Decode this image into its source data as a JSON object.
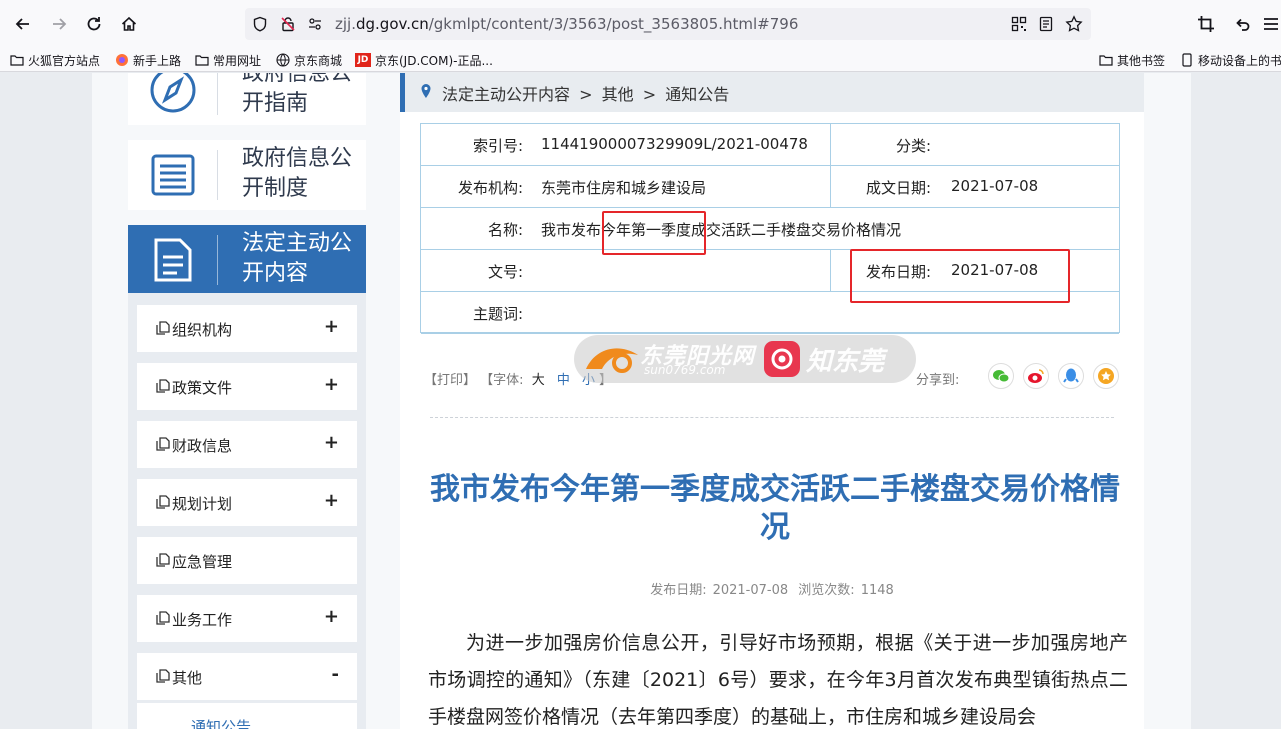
{
  "browser": {
    "url_prefix": "zjj.",
    "url_domain": "dg.gov.cn",
    "url_path": "/gkmlpt/content/3/3563/post_3563805.html#796",
    "bookmarks": [
      "火狐官方站点",
      "新手上路",
      "常用网址",
      "京东商城",
      "京东(JD.COM)-正品..."
    ],
    "bookmarks_right": [
      "其他书签",
      "移动设备上的书签"
    ]
  },
  "sidebar": {
    "panels": [
      {
        "label": "政府信息公开指南",
        "icon": "compass-icon"
      },
      {
        "label": "政府信息公开制度",
        "icon": "list-icon"
      },
      {
        "label": "法定主动公开内容",
        "icon": "document-icon"
      }
    ],
    "menu": [
      {
        "label": "组织机构",
        "toggle": "+"
      },
      {
        "label": "政策文件",
        "toggle": "+"
      },
      {
        "label": "财政信息",
        "toggle": "+"
      },
      {
        "label": "规划计划",
        "toggle": "+"
      },
      {
        "label": "应急管理",
        "toggle": ""
      },
      {
        "label": "业务工作",
        "toggle": "+"
      },
      {
        "label": "其他",
        "toggle": "-"
      }
    ],
    "submenu": "通知公告"
  },
  "breadcrumb": {
    "items": [
      "法定主动公开内容",
      "其他",
      "通知公告"
    ],
    "separator": ">"
  },
  "info": {
    "index_label": "索引号:",
    "index_value": "11441900007329909L/2021-00478",
    "category_label": "分类:",
    "category_value": "",
    "publisher_label": "发布机构:",
    "publisher_value": "东莞市住房和城乡建设局",
    "created_label": "成文日期:",
    "created_value": "2021-07-08",
    "name_label": "名称:",
    "name_value": "我市发布今年第一季度成交活跃二手楼盘交易价格情况",
    "docno_label": "文号:",
    "docno_value": "",
    "pubdate_label": "发布日期:",
    "pubdate_value": "2021-07-08",
    "keywords_label": "主题词:",
    "keywords_value": ""
  },
  "tools": {
    "print": "【打印】",
    "font_label": "【字体:",
    "font_large": "大",
    "font_medium": "中",
    "font_small": "小",
    "font_close": "】",
    "share_label": "分享到:"
  },
  "watermark": {
    "brand1": "东莞阳光网",
    "brand1_sub": "sun0769.com",
    "brand2": "知东莞"
  },
  "article": {
    "title": "我市发布今年第一季度成交活跃二手楼盘交易价格情况",
    "meta_date_label": "发布日期:",
    "meta_date": "2021-07-08",
    "meta_views_label": "浏览次数:",
    "meta_views": "1148",
    "body": "为进一步加强房价信息公开，引导好市场预期，根据《关于进一步加强房地产市场调控的通知》（东建〔2021〕6号）要求，在今年3月首次发布典型镇街热点二手楼盘网签价格情况（去年第四季度）的基础上，市住房和城乡建设局会"
  },
  "colors": {
    "accent": "#2f6eb3",
    "highlight": "#e5262a",
    "table_border": "#a9cfe6"
  }
}
